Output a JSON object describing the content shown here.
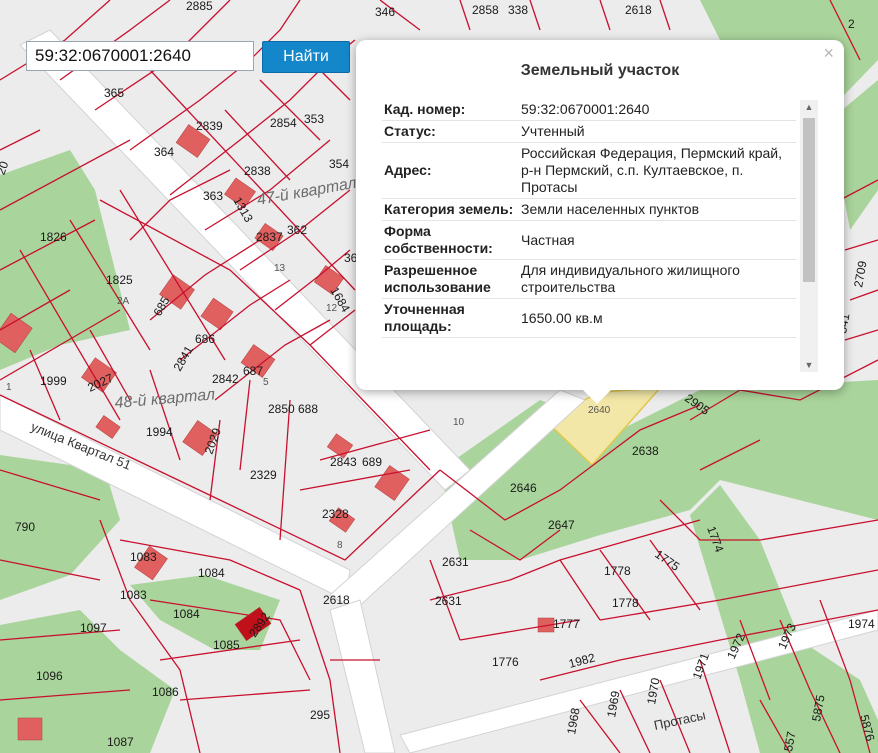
{
  "search": {
    "value": "59:32:0670001:2640",
    "button_label": "Найти"
  },
  "popup": {
    "title": "Земельный участок",
    "close_glyph": "×",
    "rows": [
      {
        "label": "Кад. номер:",
        "value": "59:32:0670001:2640"
      },
      {
        "label": "Статус:",
        "value": "Учтенный"
      },
      {
        "label": "Адрес:",
        "value": "Российская Федерация, Пермский край, р-н Пермский, с.п. Култаевское, п. Протасы"
      },
      {
        "label": "Категория земель:",
        "value": "Земли населенных пунктов"
      },
      {
        "label": "Форма собственности:",
        "value": "Частная"
      },
      {
        "label": "Разрешенное использование",
        "value": "Для индивидуального жилищного строительства"
      },
      {
        "label": "Уточненная площадь:",
        "value": "1650.00 кв.м"
      }
    ],
    "scroll_up_glyph": "▲",
    "scroll_down_glyph": "▼"
  },
  "map": {
    "colors": {
      "background": "#ececec",
      "forest": "#a9d49b",
      "parcel_line": "#c8102e",
      "road": "#ffffff",
      "building": "#e06060",
      "selected": "#f3e7a8"
    },
    "quarter_labels": [
      "47-й квартал",
      "48-й квартал"
    ],
    "street_labels": [
      "улица Квартал 51",
      "Протасы"
    ],
    "parcel_labels": [
      "2885",
      "346",
      "2858",
      "338",
      "2618",
      "2",
      "365",
      "2839",
      "2854",
      "353",
      "364",
      "2838",
      "354",
      "363",
      "1313",
      "2837",
      "362",
      "36",
      "1826",
      "1825",
      "685",
      "686",
      "2841",
      "687",
      "2842",
      "2850",
      "688",
      "1684",
      "2709",
      "1999",
      "2027",
      "1994",
      "2029",
      "2329",
      "2843",
      "689",
      "2328",
      "790",
      "1083",
      "1084",
      "1083",
      "1097",
      "1084",
      "1085",
      "2892",
      "1096",
      "1086",
      "1087",
      "295",
      "2618",
      "2640",
      "2905",
      "2638",
      "2646",
      "2647",
      "1774",
      "2631",
      "1775",
      "1778",
      "2631",
      "1778",
      "1777",
      "1776",
      "1982",
      "1970",
      "1971",
      "1972",
      "1973",
      "1974",
      "1969",
      "1968",
      "5875",
      "5876",
      "557",
      "10",
      "2А",
      "13",
      "12",
      "5",
      "8",
      "541",
      "1",
      "20"
    ]
  }
}
